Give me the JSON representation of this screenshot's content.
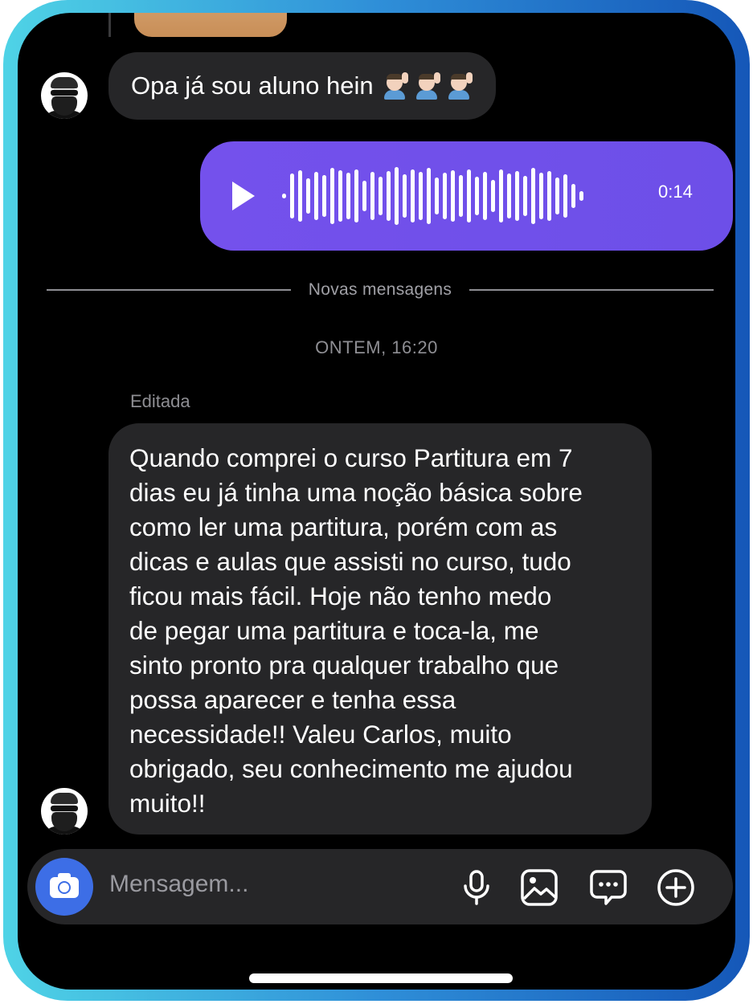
{
  "messages": {
    "short_incoming": "Opa já sou aluno hein",
    "short_incoming_emoji": [
      "person-raising-hand",
      "person-raising-hand",
      "person-raising-hand"
    ],
    "voice_note": {
      "duration": "0:14"
    },
    "new_messages_divider": "Novas mensagens",
    "timestamp": "ONTEM, 16:20",
    "edited_label": "Editada",
    "long_incoming_lines": [
      "Quando comprei o curso Partitura em 7",
      "dias eu já tinha uma noção básica sobre",
      "como ler uma partitura, porém com as",
      "dicas e aulas que assisti no curso, tudo",
      "ficou mais fácil. Hoje não tenho medo",
      "de pegar uma partitura e toca-la, me",
      "sinto pronto pra qualquer trabalho que",
      "possa aparecer e tenha essa",
      "necessidade!! Valeu Carlos, muito",
      "obrigado, seu conhecimento me ajudou",
      "muito!!"
    ]
  },
  "composer": {
    "placeholder": "Mensagem...",
    "icons": [
      "camera-icon",
      "microphone-icon",
      "gallery-icon",
      "sticker-chat-icon",
      "plus-circle-icon"
    ]
  },
  "colors": {
    "frame_gradient": [
      "#4fd3e6",
      "#1557b8"
    ],
    "screen_bg": "#000000",
    "incoming_bubble": "#262628",
    "outgoing_bubble": "#7451ec",
    "camera_button": "#3d6ee6"
  }
}
